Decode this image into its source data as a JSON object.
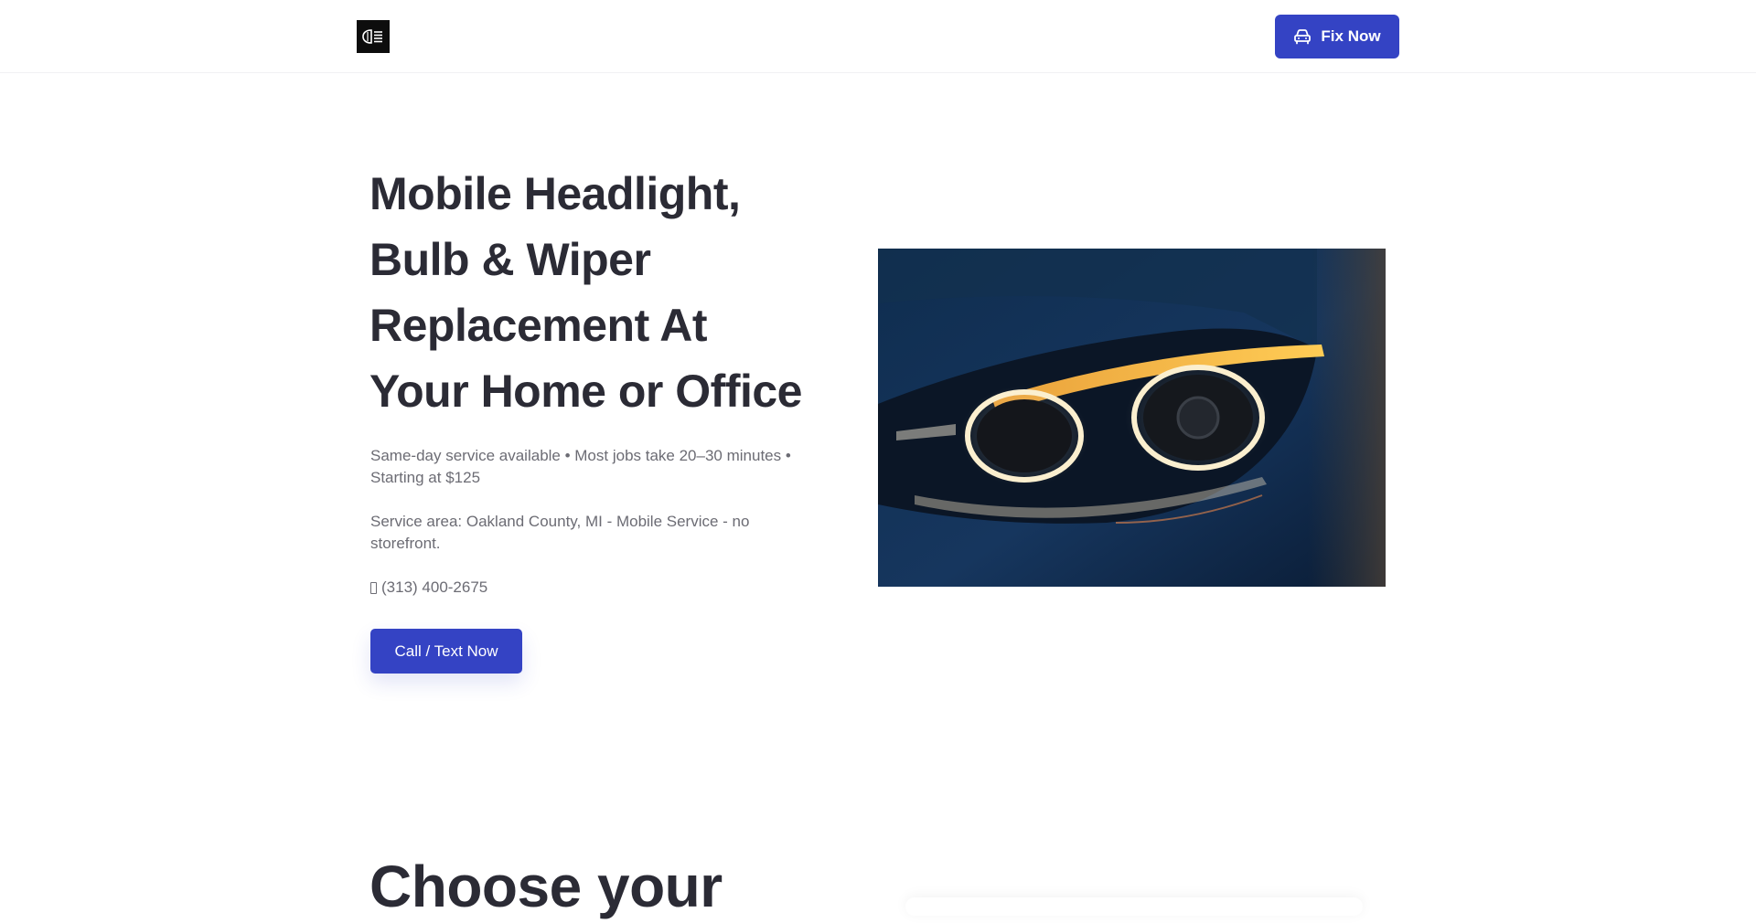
{
  "header": {
    "logo_icon": "headlight-logo-icon",
    "fix_button": {
      "label": "Fix Now",
      "icon": "car-icon"
    }
  },
  "hero": {
    "title": "Mobile Headlight, Bulb & Wiper Replacement At Your Home or Office",
    "details": "Same-day service available • Most jobs take 20–30 minutes • Starting at $125",
    "service_area": "Service area: Oakland County, MI - Mobile Service - no storefront.",
    "phone": "(313) 400-2675",
    "phone_icon": "phone-icon",
    "cta_label": "Call / Text Now",
    "image_icon": "car-headlight-image"
  },
  "next_section": {
    "title": "Choose your"
  },
  "colors": {
    "accent": "#3443c4",
    "heading": "#2b2b35",
    "body_text": "#6c6c74",
    "logo_bg": "#0d0d0d"
  }
}
